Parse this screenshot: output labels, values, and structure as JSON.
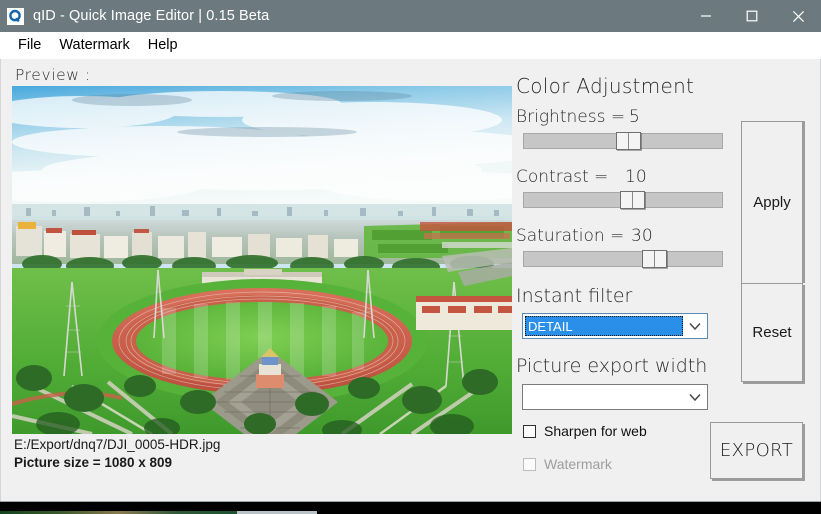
{
  "window": {
    "title": "qID - Quick Image Editor | 0.15 Beta",
    "icon": "app-q-icon",
    "titlebar_color": "#6c7a80",
    "minimize_label": "Minimize",
    "maximize_label": "Maximize",
    "close_label": "Close"
  },
  "menubar": {
    "items": [
      {
        "label": "File"
      },
      {
        "label": "Watermark"
      },
      {
        "label": "Help"
      }
    ]
  },
  "preview": {
    "heading": "Preview  :",
    "filepath": "E:/Export/dnq7/DJI_0005-HDR.jpg",
    "picture_size": "Picture size = 1080 x 809"
  },
  "color_adjustment": {
    "heading": "Color Adjustment",
    "sliders": [
      {
        "label": "Brightness =",
        "value": "5",
        "percent": 52
      },
      {
        "label": "Contrast =",
        "value": "10",
        "percent": 54
      },
      {
        "label": "Saturation =",
        "value": "30",
        "percent": 62
      }
    ]
  },
  "instant_filter": {
    "heading": "Instant filter",
    "selected": "DETAIL",
    "arrow_icon": "chevron-down-icon"
  },
  "export_width": {
    "heading": "Picture export width",
    "selected": "",
    "arrow_icon": "chevron-down-icon"
  },
  "options": {
    "sharpen": {
      "label": "Sharpen for web",
      "checked": false,
      "enabled": true
    },
    "watermark": {
      "label": "Watermark",
      "checked": false,
      "enabled": false
    }
  },
  "actions": {
    "apply": "Apply",
    "reset": "Reset",
    "export": "EXPORT"
  },
  "colors": {
    "accent_blue": "#2a8fe8",
    "titlebar": "#6c7a80",
    "surface": "#f0f0f0"
  }
}
